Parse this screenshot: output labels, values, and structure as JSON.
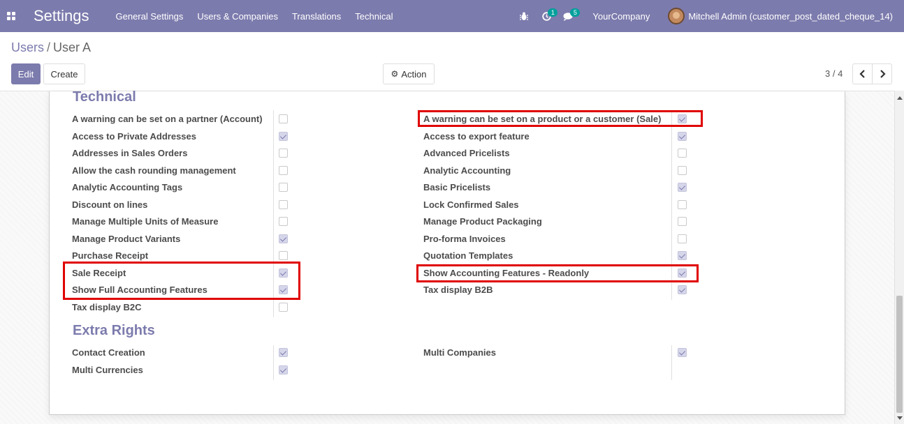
{
  "navbar": {
    "app_title": "Settings",
    "menu": [
      "General Settings",
      "Users & Companies",
      "Translations",
      "Technical"
    ],
    "activity_count": "1",
    "message_count": "5",
    "company": "YourCompany",
    "user": "Mitchell Admin (customer_post_dated_cheque_14)"
  },
  "breadcrumb": {
    "parent": "Users",
    "current": "User A"
  },
  "controls": {
    "edit": "Edit",
    "create": "Create",
    "action": "Action",
    "pager": "3 / 4"
  },
  "technical": {
    "title": "Technical",
    "left": [
      {
        "label": "A warning can be set on a partner (Account)",
        "checked": false
      },
      {
        "label": "Access to Private Addresses",
        "checked": true
      },
      {
        "label": "Addresses in Sales Orders",
        "checked": false
      },
      {
        "label": "Allow the cash rounding management",
        "checked": false
      },
      {
        "label": "Analytic Accounting Tags",
        "checked": false
      },
      {
        "label": "Discount on lines",
        "checked": false
      },
      {
        "label": "Manage Multiple Units of Measure",
        "checked": false
      },
      {
        "label": "Manage Product Variants",
        "checked": true
      },
      {
        "label": "Purchase Receipt",
        "checked": false
      },
      {
        "label": "Sale Receipt",
        "checked": true
      },
      {
        "label": "Show Full Accounting Features",
        "checked": true
      },
      {
        "label": "Tax display B2C",
        "checked": false
      }
    ],
    "right": [
      {
        "label": "A warning can be set on a product or a customer (Sale)",
        "checked": true
      },
      {
        "label": "Access to export feature",
        "checked": true
      },
      {
        "label": "Advanced Pricelists",
        "checked": false
      },
      {
        "label": "Analytic Accounting",
        "checked": false
      },
      {
        "label": "Basic Pricelists",
        "checked": true
      },
      {
        "label": "Lock Confirmed Sales",
        "checked": false
      },
      {
        "label": "Manage Product Packaging",
        "checked": false
      },
      {
        "label": "Pro-forma Invoices",
        "checked": false
      },
      {
        "label": "Quotation Templates",
        "checked": true
      },
      {
        "label": "Show Accounting Features - Readonly",
        "checked": true
      },
      {
        "label": "Tax display B2B",
        "checked": true
      }
    ]
  },
  "extra_rights": {
    "title": "Extra Rights",
    "left": [
      {
        "label": "Contact Creation",
        "checked": true
      },
      {
        "label": "Multi Currencies",
        "checked": true
      }
    ],
    "right": [
      {
        "label": "Multi Companies",
        "checked": true
      }
    ]
  },
  "colors": {
    "brand": "#7c7bad",
    "badge": "#00a09d",
    "highlight": "#e00000"
  }
}
